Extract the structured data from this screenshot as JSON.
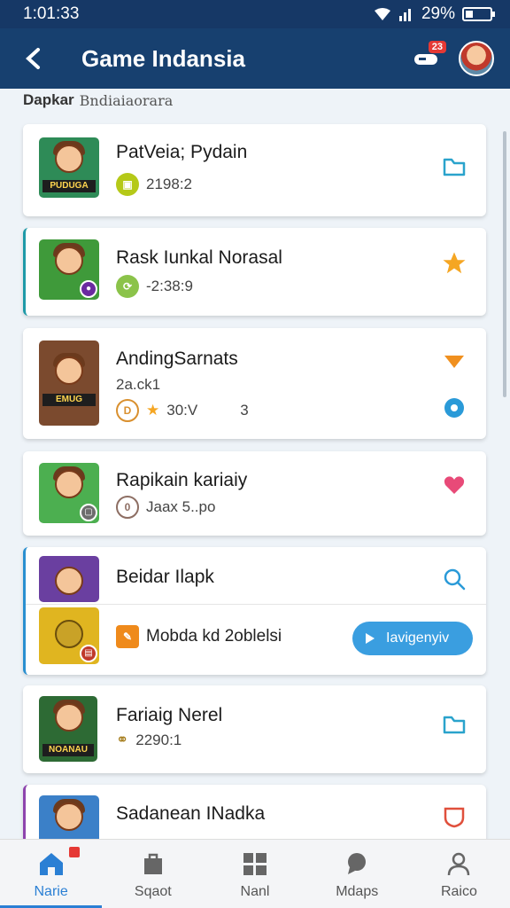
{
  "status": {
    "time": "1:01:33",
    "battery": "29%",
    "battery_level": 0.29
  },
  "app_bar": {
    "title": "Game Indansia",
    "notif_badge": "23"
  },
  "subheader": {
    "strong": "Dapkar",
    "light": "Bndiaiaorara"
  },
  "games": [
    {
      "title": "PatVeia; Pydain",
      "meta": "2198:2",
      "thumb_label": "PUDUGA",
      "thumb_color": "#2e8b57",
      "meta_icon_color": "#b5c918",
      "action": "folder-icon"
    },
    {
      "title": "Rask Iunkal Norasal",
      "meta": "-2:38:9",
      "thumb_label": "",
      "thumb_color": "#3f9a3a",
      "meta_icon_color": "#8bc34a",
      "action": "star-icon"
    },
    {
      "title": "AndingSarnats",
      "subtitle": "2a.ck1",
      "meta": "30:V",
      "meta2": "3",
      "thumb_label": "EMUG",
      "thumb_color": "#7b4a2e",
      "meta_icon_color": "#d9902f",
      "action": "chevron-down-icon",
      "action2": "refresh-icon"
    },
    {
      "title": "Rapikain kariaiy",
      "meta": "Jaax 5..po",
      "thumb_label": "",
      "thumb_color": "#4caf50",
      "meta_icon_color": "#8d6e63",
      "action": "heart-icon"
    },
    {
      "title": "Beidar Ilapk",
      "meta": "Mobda kd 2oblelsi",
      "thumb_label": "",
      "thumb_color": "#6a3fa0",
      "meta_icon_color": "#ef8a1b",
      "action": "search-icon",
      "play_label": "Iavigenyiv"
    },
    {
      "title": "Fariaig Nerel",
      "meta": "2290:1",
      "thumb_label": "NOANAU",
      "thumb_color": "#2d6a34",
      "meta_icon_color": "#a57c1b",
      "action": "folder-icon"
    },
    {
      "title": "Sadanean INadka",
      "meta": "",
      "thumb_label": "",
      "thumb_color": "#3b80c8",
      "meta_icon_color": "#777",
      "action": "shield-icon"
    }
  ],
  "bottom_nav": [
    {
      "label": "Narie",
      "icon": "home-icon",
      "active": true
    },
    {
      "label": "Sqaot",
      "icon": "bag-icon",
      "active": false
    },
    {
      "label": "Nanl",
      "icon": "grid-icon",
      "active": false
    },
    {
      "label": "Mdaps",
      "icon": "map-pin-icon",
      "active": false
    },
    {
      "label": "Raico",
      "icon": "profile-icon",
      "active": false
    }
  ],
  "colors": {
    "primary": "#17406f",
    "accent": "#2a7fd4",
    "play": "#3a9ee0"
  }
}
